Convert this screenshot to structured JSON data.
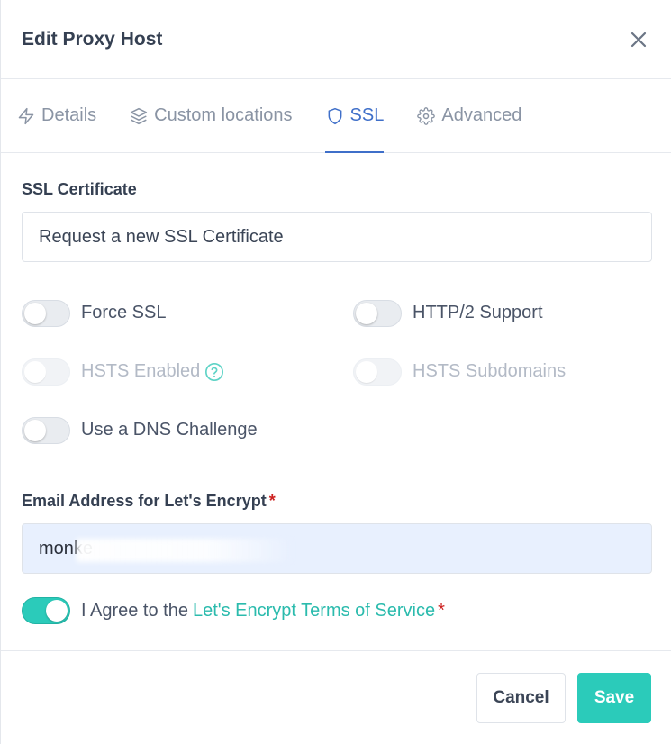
{
  "header": {
    "title": "Edit Proxy Host"
  },
  "tabs": [
    {
      "label": "Details",
      "icon": "zap-icon",
      "active": false
    },
    {
      "label": "Custom locations",
      "icon": "layers-icon",
      "active": false
    },
    {
      "label": "SSL",
      "icon": "shield-icon",
      "active": true
    },
    {
      "label": "Advanced",
      "icon": "gear-icon",
      "active": false
    }
  ],
  "ssl": {
    "certificate_label": "SSL Certificate",
    "certificate_value": "Request a new SSL Certificate",
    "toggles": {
      "force_ssl": {
        "label": "Force SSL",
        "on": false,
        "disabled": false
      },
      "http2": {
        "label": "HTTP/2 Support",
        "on": false,
        "disabled": false
      },
      "hsts": {
        "label": "HSTS Enabled",
        "on": false,
        "disabled": true
      },
      "hsts_sub": {
        "label": "HSTS Subdomains",
        "on": false,
        "disabled": true
      },
      "dns": {
        "label": "Use a DNS Challenge",
        "on": false,
        "disabled": false
      }
    },
    "email_label": "Email Address for Let's Encrypt",
    "email_required": "*",
    "email_value": "monke",
    "agree_text": "I Agree to the",
    "agree_link": "Let's Encrypt Terms of Service",
    "agree_required": "*",
    "agree_on": true
  },
  "footer": {
    "cancel_label": "Cancel",
    "save_label": "Save"
  },
  "colors": {
    "accent": "#2bcbba",
    "tab_active": "#3f6fc9",
    "required": "#cd201f"
  }
}
